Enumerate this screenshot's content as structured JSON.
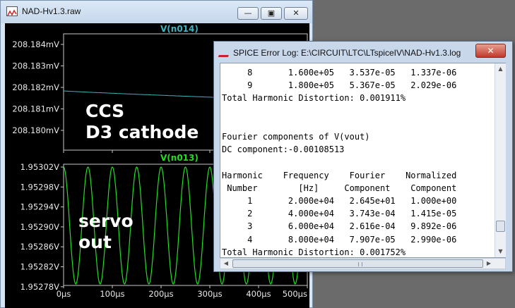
{
  "wave_window": {
    "title": "NAD-Hv1.3.raw",
    "min_glyph": "—",
    "max_glyph": "▣",
    "close_glyph": "✕"
  },
  "plot": {
    "top_pane": {
      "trace_name": "V(n014)",
      "color": "#3fb5c0",
      "y_ticks": [
        "208.184mV",
        "208.183mV",
        "208.182mV",
        "208.181mV",
        "208.180mV"
      ],
      "overlay_label": "CCS\nD3 cathode"
    },
    "bottom_pane": {
      "trace_name": "V(n013)",
      "color": "#22dd22",
      "y_ticks": [
        "1.95302V",
        "1.95298V",
        "1.95294V",
        "1.95290V",
        "1.95286V",
        "1.95282V",
        "1.95278V"
      ],
      "overlay_label": "servo\nout",
      "cycles": 10
    },
    "x_ticks": [
      "0µs",
      "100µs",
      "200µs",
      "300µs",
      "400µs",
      "500µs"
    ]
  },
  "log_window": {
    "title": "SPICE Error Log: E:\\CIRCUIT\\LTC\\LTspiceIV\\NAD-Hv1.3.log",
    "close_glyph": "✕",
    "lines": [
      "     8       1.600e+05   3.537e-05   1.337e-06",
      "     9       1.800e+05   5.367e-05   2.029e-06",
      "Total Harmonic Distortion: 0.001911%",
      "",
      "",
      "Fourier components of V(vout)",
      "DC component:-0.00108513",
      "",
      "Harmonic    Frequency    Fourier    Normalized",
      " Number        [Hz]     Component    Component",
      "     1       2.000e+04   2.645e+01   1.000e+00",
      "     2       4.000e+04   3.743e-04   1.415e-05",
      "     3       6.000e+04   2.616e-04   9.892e-06",
      "     4       8.000e+04   7.907e-05   2.990e-06",
      "Total Harmonic Distortion: 0.001752%"
    ]
  }
}
